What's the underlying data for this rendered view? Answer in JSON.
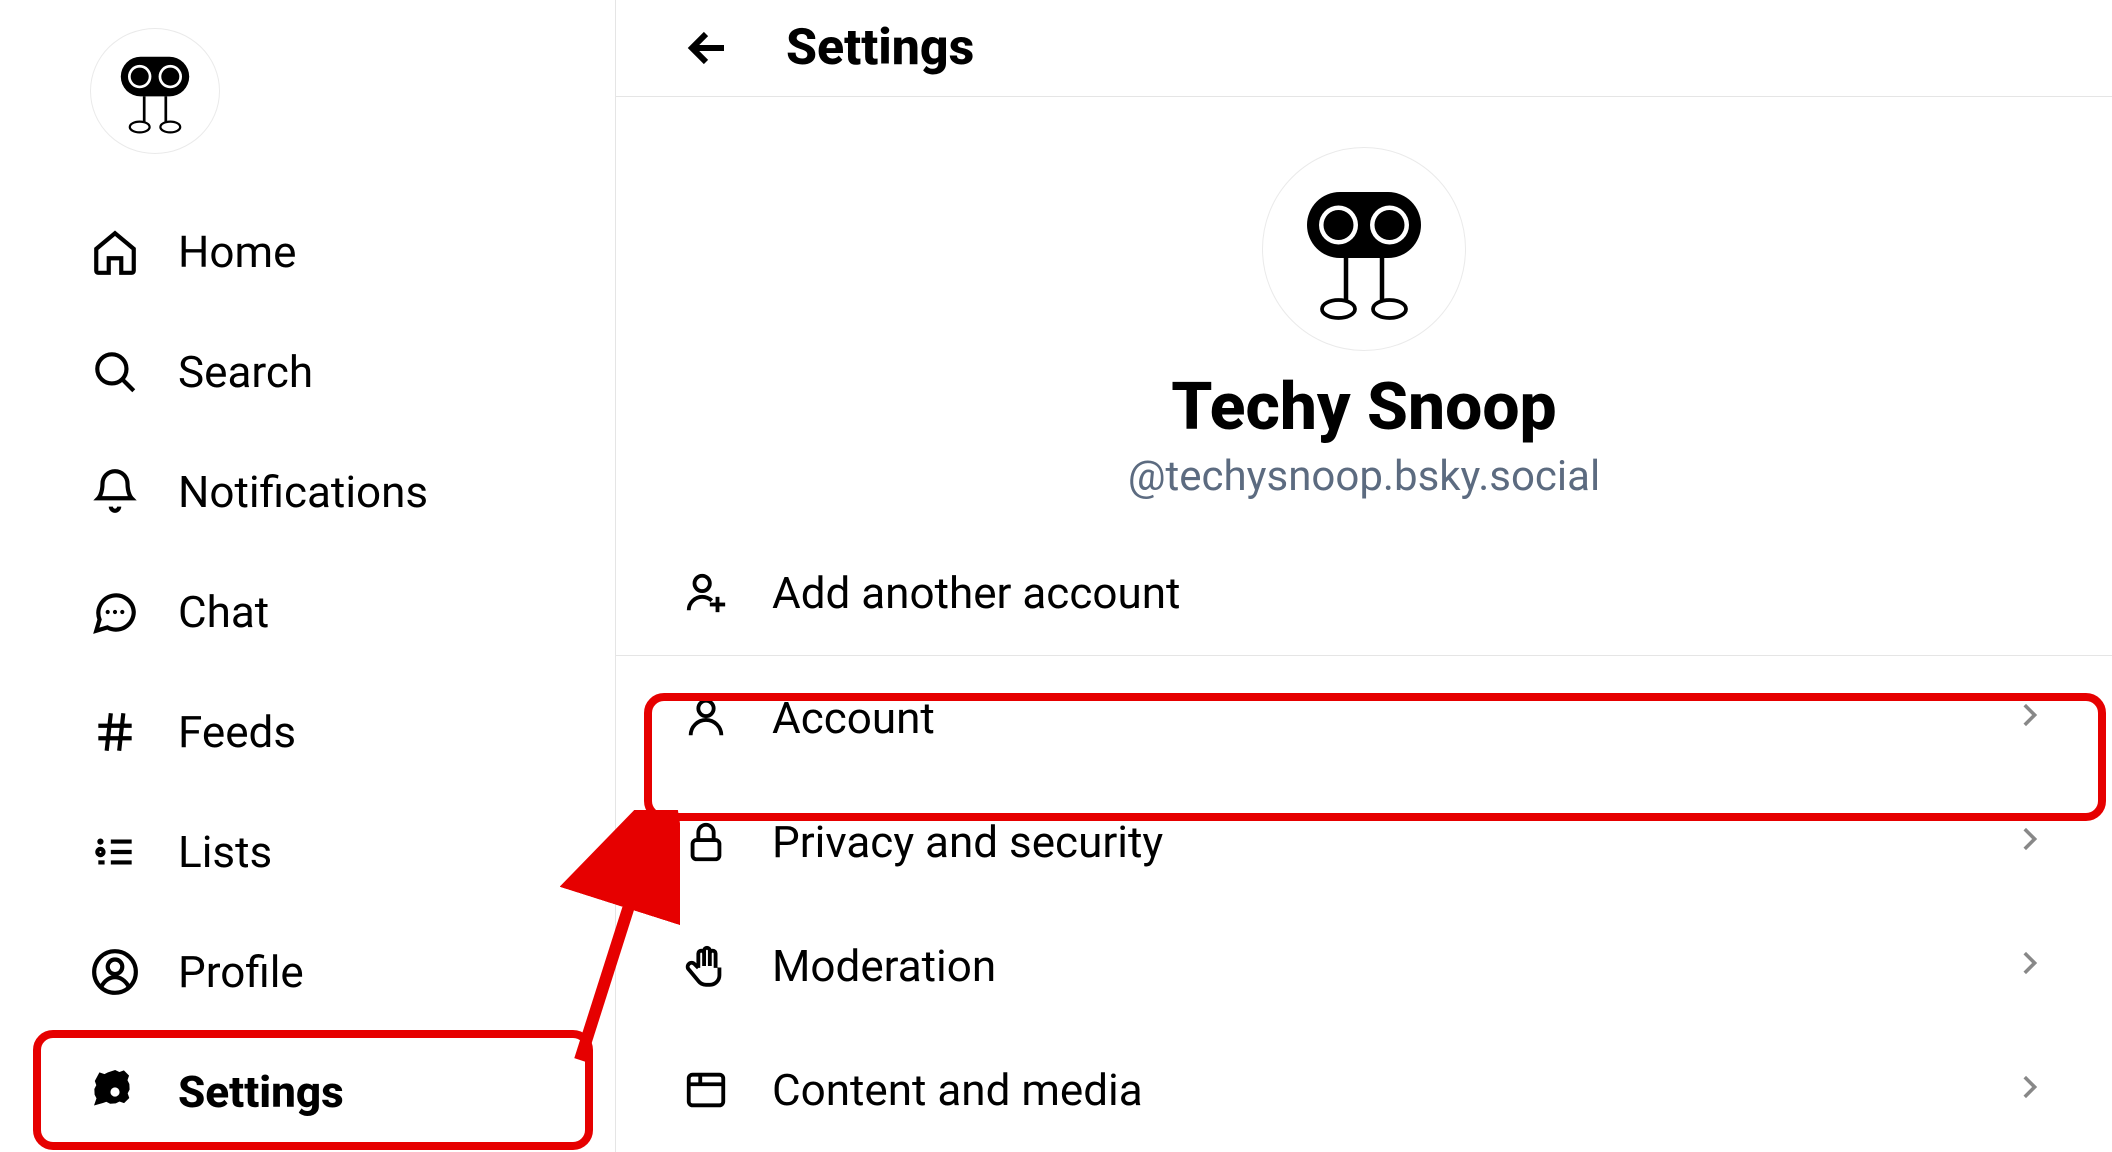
{
  "sidebar": {
    "items": [
      {
        "label": "Home"
      },
      {
        "label": "Search"
      },
      {
        "label": "Notifications"
      },
      {
        "label": "Chat"
      },
      {
        "label": "Feeds"
      },
      {
        "label": "Lists"
      },
      {
        "label": "Profile"
      },
      {
        "label": "Settings"
      }
    ]
  },
  "header": {
    "title": "Settings"
  },
  "profile": {
    "display_name": "Techy Snoop",
    "handle": "@techysnoop.bsky.social"
  },
  "actions": {
    "add_account": "Add another account"
  },
  "settings_rows": [
    {
      "label": "Account"
    },
    {
      "label": "Privacy and security"
    },
    {
      "label": "Moderation"
    },
    {
      "label": "Content and media"
    }
  ]
}
